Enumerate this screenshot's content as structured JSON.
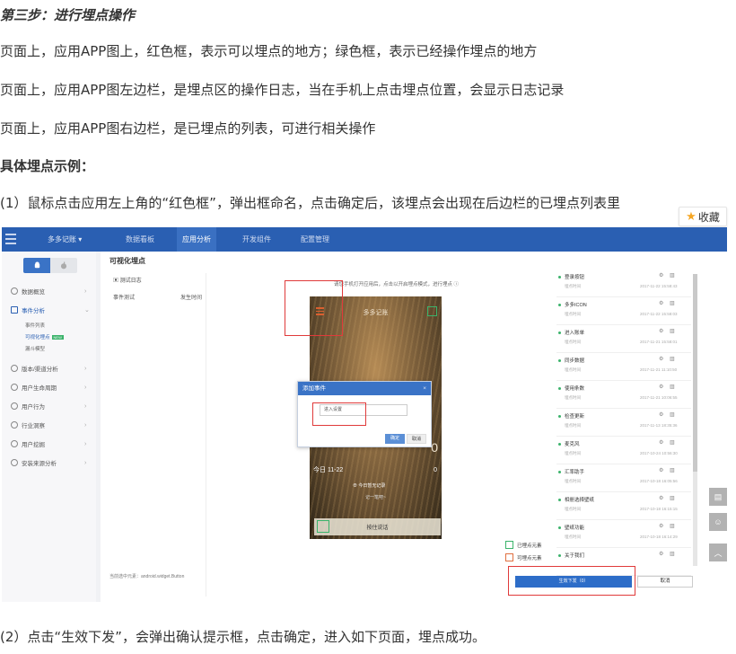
{
  "doc": {
    "step_title": "第三步：进行埋点操作",
    "para1": "页面上，应用APP图上，红色框，表示可以埋点的地方；绿色框，表示已经操作埋点的地方",
    "para2": "页面上，应用APP图左边栏，是埋点区的操作日志，当在手机上点击埋点位置，会显示日志记录",
    "para3": "页面上，应用APP图右边栏，是已埋点的列表，可进行相关操作",
    "example_title": "具体埋点示例：",
    "step1": "(1）鼠标点击应用左上角的“红色框”，弹出框命名，点击确定后，该埋点会出现在后边栏的已埋点列表里",
    "step2": "(2）点击“生效下发”，会弹出确认提示框，点击确定，进入如下页面，埋点成功。"
  },
  "favorite": {
    "icon": "star-icon",
    "label": "收藏"
  },
  "app": {
    "brand": "多多记账 ▾",
    "nav": [
      "数据看板",
      "应用分析",
      "开发组件",
      "配置管理"
    ],
    "active_nav": "应用分析",
    "page_title": "可视化埋点",
    "sidebar": [
      {
        "label": "数据概览",
        "icon": "dashboard-icon"
      },
      {
        "label": "事件分析",
        "icon": "edit-icon"
      },
      {
        "label": "版本/渠道分析",
        "icon": "version-icon"
      },
      {
        "label": "用户生命周期",
        "icon": "lifecycle-icon"
      },
      {
        "label": "用户行为",
        "icon": "users-icon"
      },
      {
        "label": "行业洞察",
        "icon": "insight-icon"
      },
      {
        "label": "用户挖掘",
        "icon": "mining-icon"
      },
      {
        "label": "安装来源分析",
        "icon": "source-icon"
      }
    ],
    "sub_items": [
      "事件列表",
      "可视化埋点",
      "漏斗模型"
    ],
    "badge_new": "NEW",
    "log": {
      "title": "测试日志",
      "col_event": "事件测试",
      "col_time": "发生时间"
    },
    "hint": "请您手机打开应用后，点击以开启埋点模式，进行埋点 ⓘ",
    "phone": {
      "title": "多多记账",
      "date": "今日  11-22",
      "big_num": "0",
      "zero": "0",
      "note": "⊕ 今日暂无记录",
      "note2": "记一笔吧~",
      "bottom_btn": "按住说话"
    },
    "dialog": {
      "title": "添加事件",
      "close": "×",
      "input_value": "进入设置",
      "ok": "确定",
      "cancel": "取消"
    },
    "events": [
      {
        "name": "登录按钮",
        "sub": "埋点时间",
        "time": "2017-11-22 15:58:43"
      },
      {
        "name": "多多ICON",
        "sub": "埋点时间",
        "time": "2017-11-22 15:58:03"
      },
      {
        "name": "进入账单",
        "sub": "埋点时间",
        "time": "2017-11-21 15:58:01"
      },
      {
        "name": "同步数据",
        "sub": "埋点时间",
        "time": "2017-11-21 11:10:50"
      },
      {
        "name": "使用条数",
        "sub": "埋点时间",
        "time": "2017-11-21 10:06:55"
      },
      {
        "name": "检查更新",
        "sub": "埋点时间",
        "time": "2017-11-13 18:35:36"
      },
      {
        "name": "麦克风",
        "sub": "埋点时间",
        "time": "2017-10-24 10:56:30"
      },
      {
        "name": "汇率助手",
        "sub": "埋点时间",
        "time": "2017-10-18 16:05:56"
      },
      {
        "name": "相册选择壁纸",
        "sub": "埋点时间",
        "time": "2017-10-18 16:15:15"
      },
      {
        "name": "壁纸功能",
        "sub": "埋点时间",
        "time": "2017-10-18 16:14:29"
      },
      {
        "name": "关于我们",
        "sub": "",
        "time": ""
      }
    ],
    "legend_done": "已埋点元素",
    "legend_todo": "可埋点元素",
    "selected_element": "当前选中元素：android.widget.Button",
    "publish": "生效下发（0）",
    "cancel": "取消",
    "colors": {
      "nav": "#2a5fb2",
      "red": "#e03a3a",
      "green": "#3bb36b"
    }
  }
}
